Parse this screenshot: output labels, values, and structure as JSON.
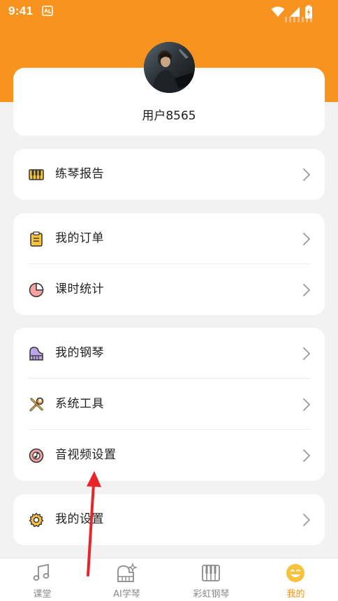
{
  "status_bar": {
    "time": "9:41"
  },
  "profile": {
    "username": "用户8565"
  },
  "sections": {
    "report": {
      "label": "练琴报告"
    },
    "orders": {
      "label": "我的订单"
    },
    "stats": {
      "label": "课时统计"
    },
    "piano": {
      "label": "我的钢琴"
    },
    "tools": {
      "label": "系统工具"
    },
    "av_settings": {
      "label": "音视频设置"
    },
    "settings": {
      "label": "我的设置"
    }
  },
  "tabs": [
    {
      "label": "课堂",
      "icon": "music-note-icon"
    },
    {
      "label": "AI学琴",
      "icon": "ai-piano-icon"
    },
    {
      "label": "彩虹钢琴",
      "icon": "piano-keys-icon"
    },
    {
      "label": "我的",
      "icon": "smiley-icon"
    }
  ],
  "colors": {
    "accent": "#f7931e",
    "background": "#f2f2f2",
    "annotation_arrow": "#e8232a"
  }
}
